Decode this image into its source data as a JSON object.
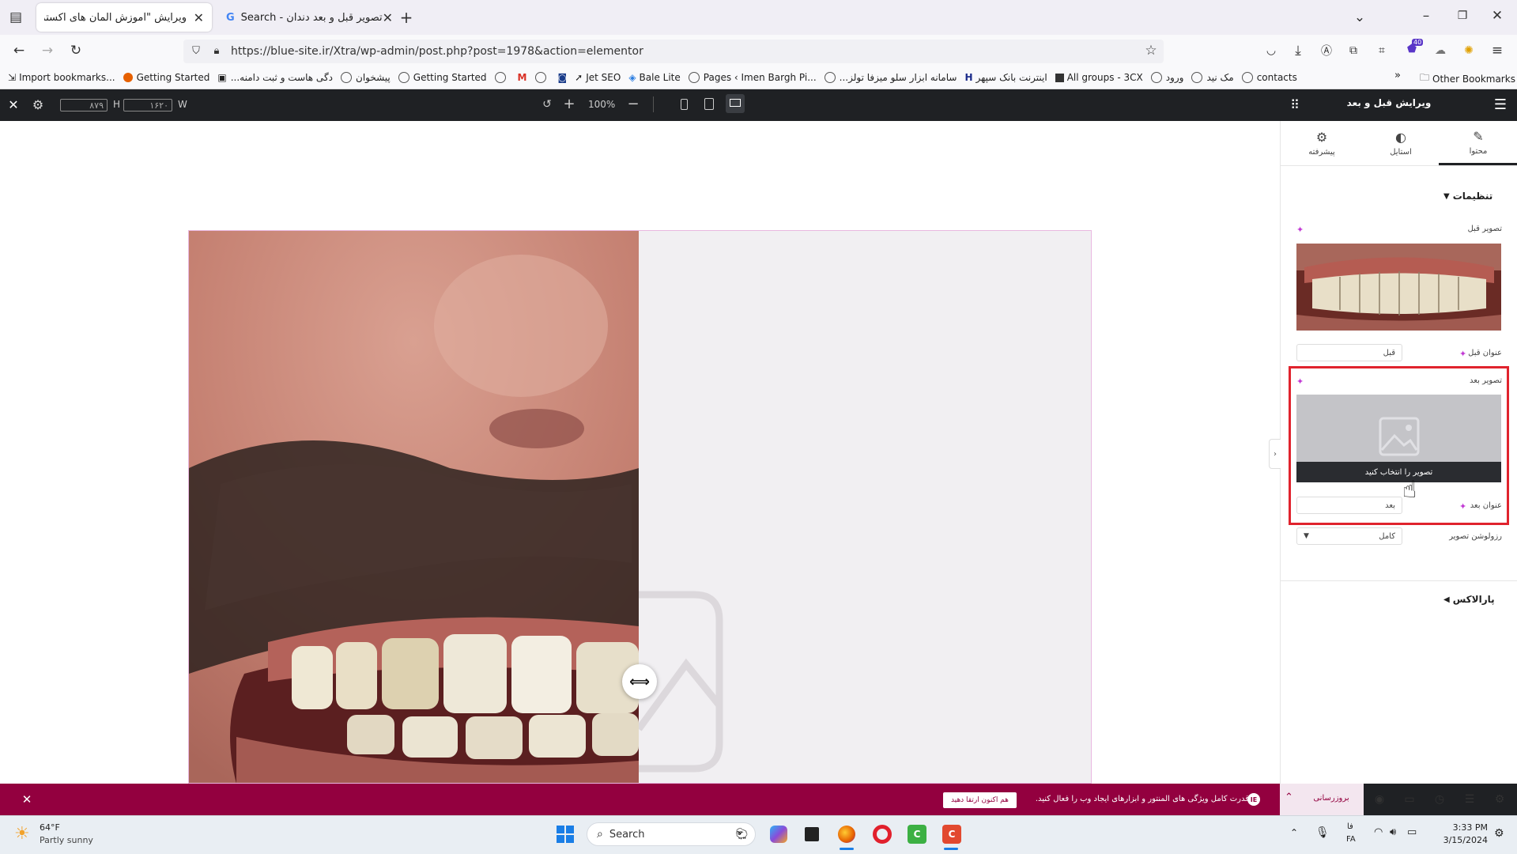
{
  "browser": {
    "tabs": [
      {
        "title": "ویرایش \"آموزش المان های اکسترا – ..."
      },
      {
        "title": "Search - تصویر قبل و بعد دندان"
      }
    ],
    "url": "https://blue-site.ir/Xtra/wp-admin/post.php?post=1978&action=elementor",
    "extension_badge": "40",
    "bookmarks": [
      "Import bookmarks...",
      "Getting Started",
      "...دگی هاست و ثبت دامنه",
      "پیشخوان",
      "Getting Started",
      "Jet SEO",
      "Bale Lite",
      "Pages ‹ Imen Bargh Pi...",
      "...سامانه ابزار سلو میزفا تولز",
      "اینترنت بانک سپهر",
      "All groups - 3CX",
      "ورود",
      "مک نید",
      "contacts"
    ],
    "other_bookmarks": "Other Bookmarks"
  },
  "editor_topbar": {
    "height_value": "۸۷۹",
    "height_label": "H",
    "width_value": "۱۶۲۰",
    "width_label": "W",
    "zoom": "100%"
  },
  "panel": {
    "title": "ویرایش قبل و بعد",
    "tabs": {
      "content": "محتوا",
      "style": "استایل",
      "advanced": "پیشرفته"
    },
    "section_settings": "تنظیمات",
    "before_image_label": "تصویر قبل",
    "before_title_label": "عنوان قبل",
    "before_title_value": "قبل",
    "after_image_label": "تصویر بعد",
    "choose_image": "تصویر را انتخاب کنید",
    "after_title_label": "عنوان بعد",
    "after_title_value": "بعد",
    "resolution_label": "رزولوشن تصویر",
    "resolution_value": "کامل",
    "section_parallax": "پارالاکس"
  },
  "notice": {
    "text": "قدرت کامل ویژگی های المنتور و ابزارهای ایجاد وب را فعال کنید.",
    "cta": "هم اکنون ارتقا دهید",
    "update_label": "بروزرسانی"
  },
  "taskbar": {
    "temp": "64°F",
    "weather": "Partly sunny",
    "search": "Search",
    "lang1": "فا",
    "lang2": "FA",
    "time": "3:33 PM",
    "date": "3/15/2024"
  },
  "colors": {
    "editor_dark": "#1f2124",
    "notice_bg": "#93003f",
    "highlight": "#e0232d",
    "ai_magenta": "#c23bd4"
  }
}
